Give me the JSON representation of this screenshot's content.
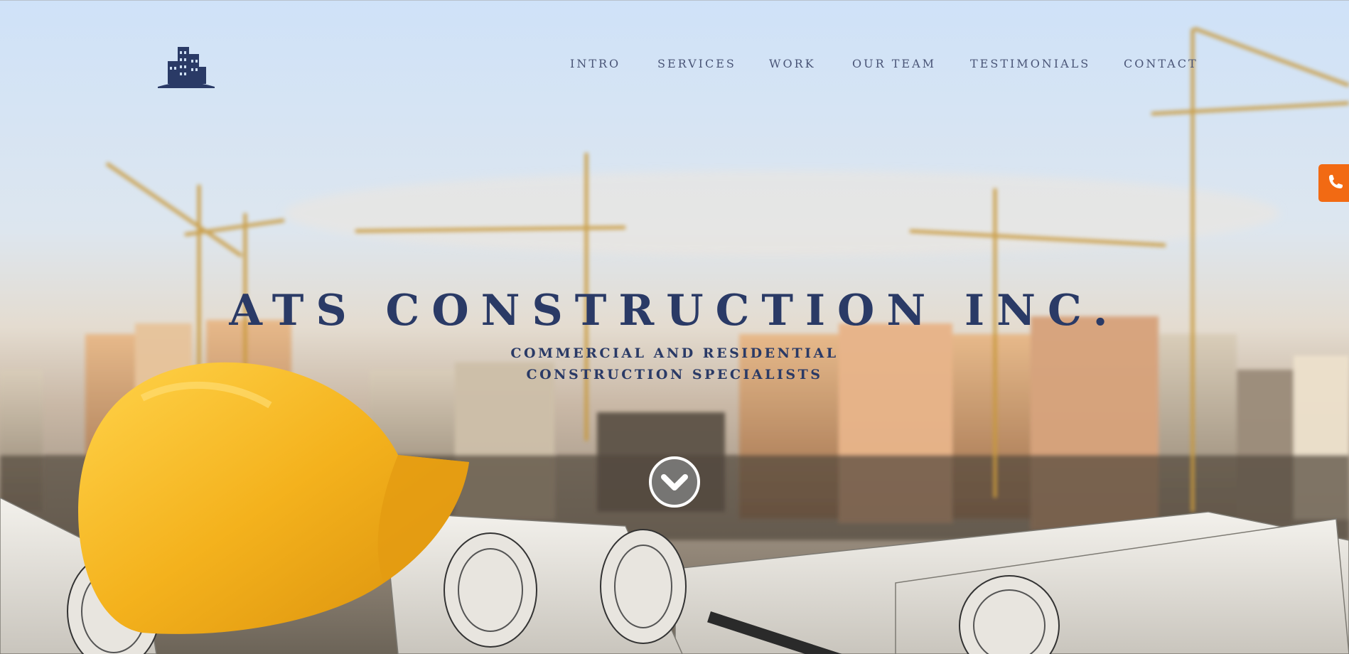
{
  "site": {
    "logo_icon": "building-skyline-icon"
  },
  "nav": {
    "items": [
      {
        "label": "INTRO"
      },
      {
        "label": "SERVICES"
      },
      {
        "label": "WORK"
      },
      {
        "label": "OUR TEAM"
      },
      {
        "label": "TESTIMONIALS"
      },
      {
        "label": "CONTACT"
      }
    ]
  },
  "hero": {
    "title": "ATS CONSTRUCTION INC.",
    "subtitle_line1": "COMMERCIAL AND RESIDENTIAL",
    "subtitle_line2": "CONSTRUCTION SPECIALISTS",
    "scroll_icon": "chevron-down-icon"
  },
  "contact_tab": {
    "icon": "phone-icon"
  },
  "colors": {
    "brand_navy": "#2a3a66",
    "nav_text": "#4a5577",
    "accent_orange": "#f26a13",
    "helmet_yellow": "#f2b21f"
  }
}
